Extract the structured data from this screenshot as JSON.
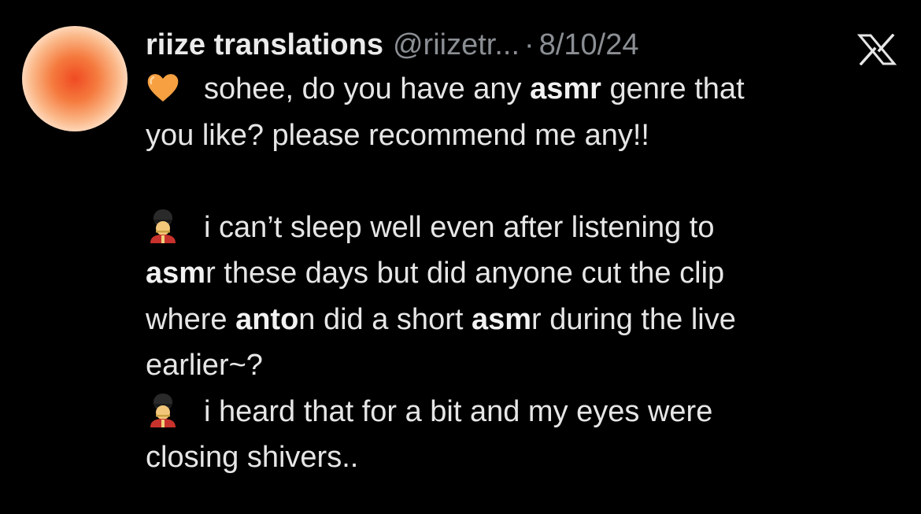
{
  "tweet": {
    "display_name": "riize translations",
    "handle": "@riizetr...",
    "separator": "·",
    "date": "8/10/24",
    "platform_icon": "x-logo-icon",
    "avatar_colors": [
      "#f04a22",
      "#fbb98a",
      "#fff6ef"
    ],
    "body": {
      "p1": {
        "emoji": "orange-heart-icon",
        "l1_t1": "sohee, do you have any ",
        "l1_b1": "asmr",
        "l1_t2": " genre that",
        "l2_t1": "you like? please recommend me any!!"
      },
      "p2": {
        "emoji": "guardsman-icon",
        "l1_t1": "i can’t sleep well even after listening to",
        "l2_b1": "asm",
        "l2_t1": "r these days but did anyone cut the clip",
        "l3_t1": "where ",
        "l3_b1": "anto",
        "l3_t2": "n did a short ",
        "l3_b2": "asm",
        "l3_t3": "r during the live",
        "l4_t1": "earlier~?"
      },
      "p3": {
        "emoji": "guardsman-icon",
        "l1_t1": "i heard that for a bit and my eyes were",
        "l2_t1": "closing shivers.."
      }
    }
  },
  "colors": {
    "background": "#000000",
    "text": "#e6e6e6",
    "muted": "#8b8f94",
    "heart": "#f6a042"
  }
}
